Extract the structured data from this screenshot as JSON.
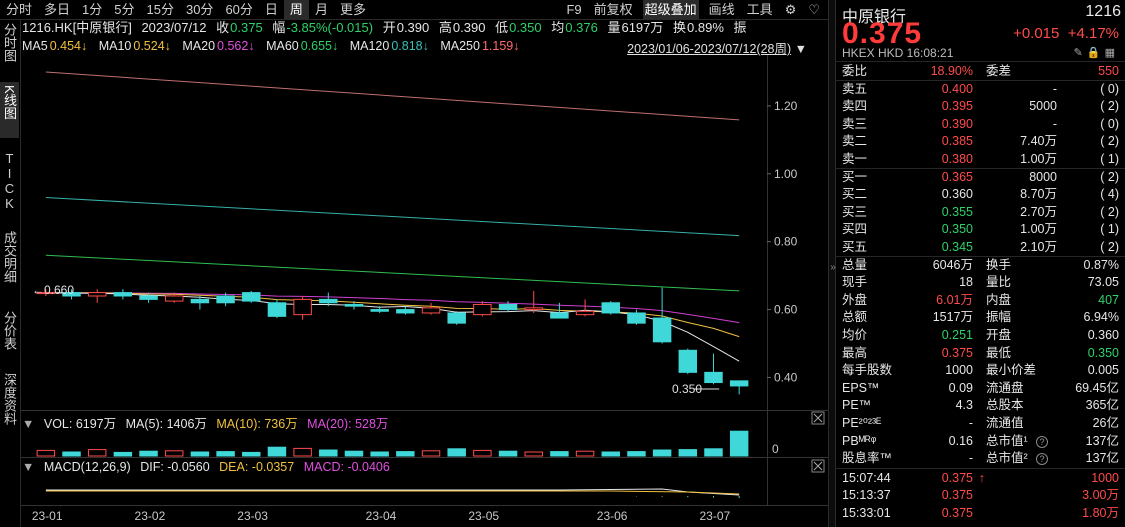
{
  "toolbar": {
    "periods": [
      "分时",
      "多日",
      "1分",
      "5分",
      "15分",
      "30分",
      "60分",
      "日",
      "周",
      "月",
      "更多"
    ],
    "active_period": "周",
    "right": [
      "F9",
      "前复权",
      "超级叠加",
      "画线",
      "工具"
    ],
    "icons": [
      "gear-icon",
      "heart-icon"
    ]
  },
  "leftnav": [
    "分时图",
    "K线图",
    "TICK",
    "成交明细",
    "分价表",
    "深度资料"
  ],
  "info": {
    "code": "1216.HK[中原银行]",
    "date": "2023/07/12",
    "close_label": "收",
    "close": "0.375",
    "amp_label": "幅",
    "amp": "-3.85%(-0.015)",
    "open_label": "开",
    "open": "0.390",
    "high_label": "高",
    "high": "0.390",
    "low_label": "低",
    "low": "0.350",
    "avg_label": "均",
    "avg": "0.376",
    "vol_label": "量",
    "vol": "6197万",
    "turn_label": "换",
    "turn": "0.89%",
    "osc_label": "振"
  },
  "ma": {
    "ma5": "MA5",
    "ma5_val": "0.454↓",
    "ma10": "MA10",
    "ma10_val": "0.524↓",
    "ma20": "MA20",
    "ma20_val": "0.562↓",
    "ma60": "MA60",
    "ma60_val": "0.655↓",
    "ma120": "MA120",
    "ma120_val": "0.818↓",
    "ma250": "MA250",
    "ma250_val": "1.159↓",
    "range": "2023/01/06-2023/07/12(28周)"
  },
  "colors": {
    "up": "#ff4b4b",
    "down": "#3fd7d7",
    "ma5": "#e6e6e6",
    "ma10": "#f0c040",
    "ma20": "#d040d0",
    "ma60": "#2fbf4f",
    "ma120": "#36b0a8",
    "ma250": "#c07070"
  },
  "chart_data": {
    "type": "candlestick",
    "x_ticks": [
      "23-01",
      "23-02",
      "23-03",
      "23-04",
      "23-05",
      "23-06",
      "23-07"
    ],
    "y_ticks": [
      "1.20",
      "1.00",
      "0.80",
      "0.60",
      "0.40"
    ],
    "ylim": [
      0.31,
      1.35
    ],
    "high_annotation": "←0.660",
    "low_annotation": "0.350",
    "candles": [
      {
        "o": 0.65,
        "c": 0.65,
        "h": 0.66,
        "l": 0.64
      },
      {
        "o": 0.65,
        "c": 0.64,
        "h": 0.66,
        "l": 0.63
      },
      {
        "o": 0.64,
        "c": 0.65,
        "h": 0.66,
        "l": 0.62
      },
      {
        "o": 0.65,
        "c": 0.64,
        "h": 0.66,
        "l": 0.63
      },
      {
        "o": 0.64,
        "c": 0.63,
        "h": 0.65,
        "l": 0.62
      },
      {
        "o": 0.625,
        "c": 0.64,
        "h": 0.65,
        "l": 0.62
      },
      {
        "o": 0.63,
        "c": 0.62,
        "h": 0.64,
        "l": 0.6
      },
      {
        "o": 0.64,
        "c": 0.62,
        "h": 0.65,
        "l": 0.61
      },
      {
        "o": 0.65,
        "c": 0.625,
        "h": 0.655,
        "l": 0.62
      },
      {
        "o": 0.62,
        "c": 0.58,
        "h": 0.63,
        "l": 0.575
      },
      {
        "o": 0.585,
        "c": 0.63,
        "h": 0.64,
        "l": 0.57
      },
      {
        "o": 0.63,
        "c": 0.62,
        "h": 0.65,
        "l": 0.61
      },
      {
        "o": 0.615,
        "c": 0.61,
        "h": 0.625,
        "l": 0.6
      },
      {
        "o": 0.6,
        "c": 0.595,
        "h": 0.61,
        "l": 0.59
      },
      {
        "o": 0.6,
        "c": 0.59,
        "h": 0.61,
        "l": 0.585
      },
      {
        "o": 0.59,
        "c": 0.605,
        "h": 0.62,
        "l": 0.585
      },
      {
        "o": 0.59,
        "c": 0.56,
        "h": 0.595,
        "l": 0.555
      },
      {
        "o": 0.585,
        "c": 0.615,
        "h": 0.625,
        "l": 0.58
      },
      {
        "o": 0.615,
        "c": 0.6,
        "h": 0.625,
        "l": 0.595
      },
      {
        "o": 0.6,
        "c": 0.605,
        "h": 0.655,
        "l": 0.59
      },
      {
        "o": 0.59,
        "c": 0.575,
        "h": 0.62,
        "l": 0.575
      },
      {
        "o": 0.585,
        "c": 0.595,
        "h": 0.63,
        "l": 0.58
      },
      {
        "o": 0.62,
        "c": 0.59,
        "h": 0.625,
        "l": 0.585
      },
      {
        "o": 0.59,
        "c": 0.56,
        "h": 0.6,
        "l": 0.555
      },
      {
        "o": 0.575,
        "c": 0.505,
        "h": 0.665,
        "l": 0.5
      },
      {
        "o": 0.48,
        "c": 0.415,
        "h": 0.485,
        "l": 0.41
      },
      {
        "o": 0.415,
        "c": 0.385,
        "h": 0.47,
        "l": 0.38
      },
      {
        "o": 0.39,
        "c": 0.375,
        "h": 0.39,
        "l": 0.35
      }
    ],
    "ma": {
      "ma250": {
        "start": 1.3,
        "end": 1.159
      },
      "ma120": {
        "start": 0.93,
        "end": 0.818
      },
      "ma60": {
        "start": 0.76,
        "end": 0.655
      }
    },
    "volume": [
      1.4,
      1.0,
      1.6,
      0.9,
      1.2,
      1.3,
      1.0,
      1.1,
      0.9,
      2.2,
      1.9,
      1.5,
      1.2,
      1.0,
      1.1,
      1.3,
      1.8,
      1.4,
      1.2,
      1.0,
      1.1,
      1.2,
      1.0,
      1.1,
      1.5,
      1.6,
      1.8,
      6.197
    ],
    "vol_ylim": [
      0,
      7.0
    ],
    "vol_tick": "0"
  },
  "vol": {
    "label": "VOL: 6197万",
    "ma5": "MA(5): 1406万",
    "ma10": "MA(10): 736万",
    "ma20": "MA(20): 528万"
  },
  "macd": {
    "label": "MACD(12,26,9)",
    "dif": "DIF: -0.0560",
    "dea": "DEA: -0.0357",
    "macd": "MACD: -0.0406"
  },
  "panel": {
    "name": "中原银行",
    "code": "1216",
    "price": "0.375",
    "change": "+0.015",
    "change_pct": "+4.17%",
    "sub": "HKEX  HKD  16:08:21",
    "wei_label": "委比",
    "wei_val": "18.90%",
    "weicha_label": "委差",
    "weicha_val": "550",
    "asks": [
      {
        "label": "卖五",
        "price": "0.400",
        "vol": "-",
        "num": "(    0)"
      },
      {
        "label": "卖四",
        "price": "0.395",
        "vol": "5000",
        "num": "(    2)"
      },
      {
        "label": "卖三",
        "price": "0.390",
        "vol": "-",
        "num": "(    0)"
      },
      {
        "label": "卖二",
        "price": "0.385",
        "vol": "7.40万",
        "num": "(    2)"
      },
      {
        "label": "卖一",
        "price": "0.380",
        "vol": "1.00万",
        "num": "(    1)"
      }
    ],
    "bids": [
      {
        "label": "买一",
        "price": "0.365",
        "vol": "8000",
        "num": "(    2)"
      },
      {
        "label": "买二",
        "price": "0.360",
        "vol": "8.70万",
        "num": "(    4)"
      },
      {
        "label": "买三",
        "price": "0.355",
        "vol": "2.70万",
        "num": "(    2)"
      },
      {
        "label": "买四",
        "price": "0.350",
        "vol": "1.00万",
        "num": "(    1)"
      },
      {
        "label": "买五",
        "price": "0.345",
        "vol": "2.10万",
        "num": "(    2)"
      }
    ],
    "stats": [
      {
        "l1": "总量",
        "v1": "6046万",
        "c1": "white",
        "l2": "换手",
        "v2": "0.87%",
        "c2": "white"
      },
      {
        "l1": "现手",
        "v1": "18",
        "c1": "white",
        "l2": "量比",
        "v2": "73.05",
        "c2": "white"
      },
      {
        "l1": "外盘",
        "v1": "6.01万",
        "c1": "red",
        "l2": "内盘",
        "v2": "407",
        "c2": "green"
      },
      {
        "l1": "总额",
        "v1": "1517万",
        "c1": "white",
        "l2": "振幅",
        "v2": "6.94%",
        "c2": "white"
      },
      {
        "l1": "均价",
        "v1": "0.251",
        "c1": "green",
        "l2": "开盘",
        "v2": "0.360",
        "c2": "white"
      },
      {
        "l1": "最高",
        "v1": "0.375",
        "c1": "red",
        "l2": "最低",
        "v2": "0.350",
        "c2": "green"
      },
      {
        "l1": "每手股数",
        "v1": "1000",
        "c1": "white",
        "l2": "最小价差",
        "v2": "0.005",
        "c2": "white"
      },
      {
        "l1": "EPS™",
        "v1": "0.09",
        "c1": "white",
        "l2": "流通盘",
        "v2": "69.45亿",
        "c2": "white"
      },
      {
        "l1": "PE™",
        "v1": "4.3",
        "c1": "white",
        "l2": "总股本",
        "v2": "365亿",
        "c2": "white"
      },
      {
        "l1": "PE²⁰²³ᴱ",
        "v1": "-",
        "c1": "white",
        "l2": "流通值",
        "v2": "26亿",
        "c2": "white"
      },
      {
        "l1": "PBᴹᴿᵠ",
        "v1": "0.16",
        "c1": "white",
        "l2": "总市值¹",
        "v2": "137亿",
        "c2": "white"
      },
      {
        "l1": "股息率™",
        "v1": "-",
        "c1": "white",
        "l2": "总市值²",
        "v2": "137亿",
        "c2": "white"
      }
    ],
    "ticks": [
      {
        "time": "15:07:44",
        "price": "0.375",
        "arrow": "↑",
        "vol": "1000",
        "vc": "red"
      },
      {
        "time": "15:13:37",
        "price": "0.375",
        "arrow": "",
        "vol": "3.00万",
        "vc": "red"
      },
      {
        "time": "15:33:01",
        "price": "0.375",
        "arrow": "",
        "vol": "1.80万",
        "vc": "red"
      }
    ]
  }
}
